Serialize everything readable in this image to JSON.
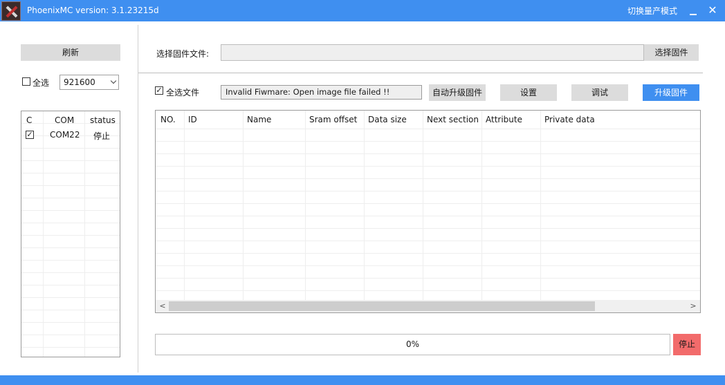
{
  "titlebar": {
    "title": "PhoenixMC version: 3.1.23215d",
    "mode_switch": "切换量产模式",
    "close": "✕"
  },
  "left": {
    "refresh": "刷新",
    "select_all": "全选",
    "select_all_checked": false,
    "baud": "921600",
    "port_headers": [
      "C",
      "COM",
      "status"
    ],
    "ports": [
      {
        "checked": true,
        "com": "COM22",
        "status": "停止"
      }
    ]
  },
  "firmware": {
    "label": "选择固件文件:",
    "path": "",
    "select_button": "选择固件"
  },
  "actions": {
    "select_files": "全选文件",
    "select_files_checked": true,
    "error_message": "Invalid Fiwmare: Open image file failed !!",
    "auto_upgrade": "自动升级固件",
    "settings": "设置",
    "debug": "调试",
    "upgrade": "升级固件"
  },
  "table": {
    "headers": [
      "NO.",
      "ID",
      "Name",
      "Sram offset",
      "Data size",
      "Next section",
      "Attribute",
      "Private data"
    ],
    "rows": []
  },
  "progress": {
    "value": 0,
    "text": "0%",
    "stop": "停止"
  },
  "colors": {
    "accent": "#3f8ff0",
    "stop": "#f26b6b",
    "button": "#dcdcdc"
  }
}
